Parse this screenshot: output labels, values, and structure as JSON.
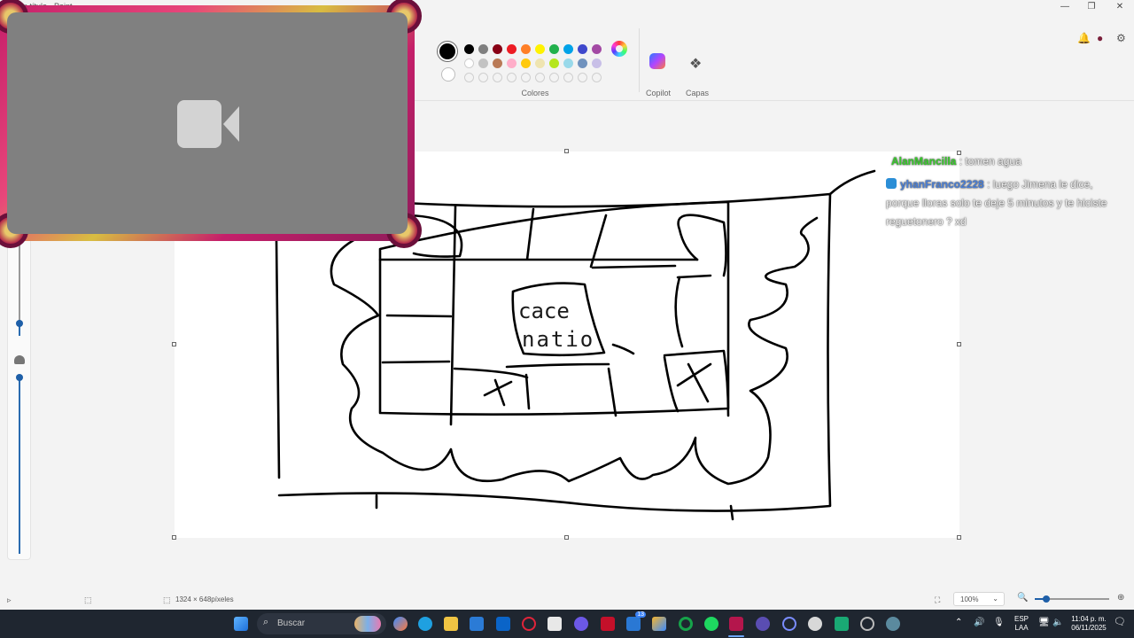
{
  "window": {
    "title": "Sin título - Paint",
    "controls": [
      "—",
      "❐",
      "✕"
    ]
  },
  "ribbon": {
    "colors_label": "Colores",
    "copilot_label": "Copilot",
    "layers_label": "Capas",
    "selected_color": "#000000",
    "swatches_row1": [
      "#000000",
      "#7f7f7f",
      "#880015",
      "#ed1c24",
      "#ff7f27",
      "#fff200",
      "#22b14c",
      "#00a2e8",
      "#3f48cc",
      "#a349a4"
    ],
    "swatches_row2": [
      "#ffffff",
      "#c3c3c3",
      "#b97a57",
      "#ffaec9",
      "#ffc90e",
      "#efe4b0",
      "#b5e61d",
      "#99d9ea",
      "#7092be",
      "#c8bfe7"
    ]
  },
  "chat": {
    "messages": [
      {
        "user": "AlanMancilla",
        "text": ": tomen agua"
      },
      {
        "user": "yhanFranco2228",
        "text": ": luego Jimena le dice, porque lloras solo te deje 5 minutos y te hiciste reguetonero ? xd"
      }
    ]
  },
  "drawing": {
    "text_line1": "cace",
    "text_line2": "natio"
  },
  "statusbar": {
    "canvas_size": "1324 × 648píxeles",
    "zoom": "100%",
    "zoom_level_fraction": 0.16
  },
  "taskbar": {
    "search_placeholder": "Buscar",
    "language": "ESP",
    "language_sub": "LAA",
    "time": "11:04 p. m.",
    "date": "06/11/2025",
    "badge_count": "13"
  }
}
